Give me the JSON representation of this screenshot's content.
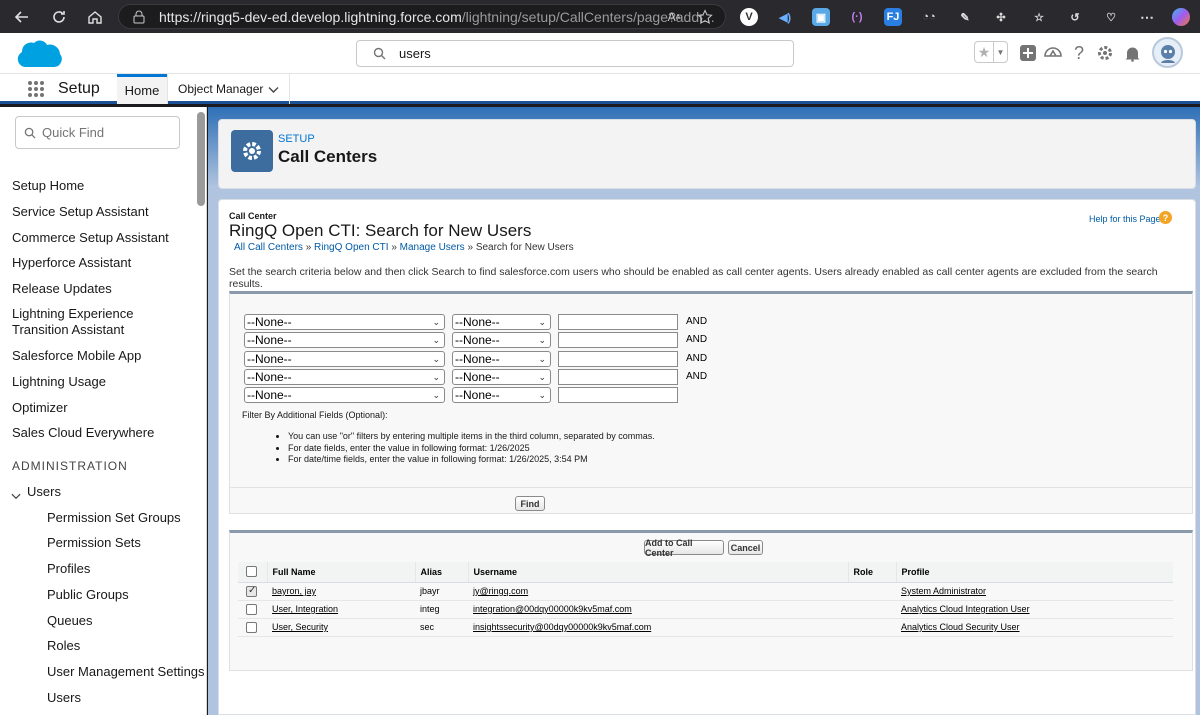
{
  "browser": {
    "url_host": "https://ringq5-dev-ed.develop.lightning.force.com",
    "url_path": "/lightning/setup/CallCenters/page?addr..."
  },
  "header": {
    "search_value": "users"
  },
  "setup_nav": {
    "app_name": "Setup",
    "tabs": [
      {
        "label": "Home",
        "active": true
      },
      {
        "label": "Object Manager",
        "active": false
      }
    ]
  },
  "sidebar": {
    "quick_find_placeholder": "Quick Find",
    "items": [
      "Setup Home",
      "Service Setup Assistant",
      "Commerce Setup Assistant",
      "Hyperforce Assistant",
      "Release Updates",
      "Lightning Experience Transition Assistant",
      "Salesforce Mobile App",
      "Lightning Usage",
      "Optimizer",
      "Sales Cloud Everywhere"
    ],
    "section_heading": "ADMINISTRATION",
    "users_node": "Users",
    "users_children": [
      "Permission Set Groups",
      "Permission Sets",
      "Profiles",
      "Public Groups",
      "Queues",
      "Roles",
      "User Management Settings",
      "Users"
    ]
  },
  "page_header": {
    "eyebrow": "SETUP",
    "title": "Call Centers"
  },
  "content": {
    "section_label": "Call Center",
    "title": "RingQ Open CTI: Search for New Users",
    "breadcrumb": {
      "links": [
        "All Call Centers",
        "RingQ Open CTI",
        "Manage Users"
      ],
      "separator": "»",
      "current": "Search for New Users"
    },
    "help_link": "Help for this Page",
    "description": "Set the search criteria below and then click Search to find salesforce.com users who should be enabled as call center agents. Users already enabled as call center agents are excluded from the search results."
  },
  "filters": {
    "rows": [
      {
        "field": "--None--",
        "operator": "--None--",
        "value": "",
        "connector": "AND"
      },
      {
        "field": "--None--",
        "operator": "--None--",
        "value": "",
        "connector": "AND"
      },
      {
        "field": "--None--",
        "operator": "--None--",
        "value": "",
        "connector": "AND"
      },
      {
        "field": "--None--",
        "operator": "--None--",
        "value": "",
        "connector": "AND"
      },
      {
        "field": "--None--",
        "operator": "--None--",
        "value": "",
        "connector": ""
      }
    ],
    "additional_label": "Filter By Additional Fields (Optional):",
    "notes": [
      "You can use \"or\" filters by entering multiple items in the third column, separated by commas.",
      "For date fields, enter the value in following format: 1/26/2025",
      "For date/time fields, enter the value in following format: 1/26/2025, 3:54 PM"
    ],
    "find_label": "Find"
  },
  "results": {
    "add_label": "Add to Call Center",
    "cancel_label": "Cancel",
    "columns": [
      "Full Name",
      "Alias",
      "Username",
      "Role",
      "Profile"
    ],
    "rows": [
      {
        "checked": true,
        "full_name": "bayron, jay",
        "alias": "jbayr",
        "username": "jy@ringq.com",
        "role": "",
        "profile": "System Administrator"
      },
      {
        "checked": false,
        "full_name": "User, Integration",
        "alias": "integ",
        "username": "integration@00dqy00000k9kv5maf.com",
        "role": "",
        "profile": "Analytics Cloud Integration User"
      },
      {
        "checked": false,
        "full_name": "User, Security",
        "alias": "sec",
        "username": "insightssecurity@00dqy00000k9kv5maf.com",
        "role": "",
        "profile": "Analytics Cloud Security User"
      }
    ]
  },
  "colors": {
    "brand_blue": "#0176d3",
    "link_blue": "#015ba7",
    "setup_band": "#1b5297",
    "gear_tile": "#3c6d9e",
    "help_orange": "#f2a424"
  }
}
